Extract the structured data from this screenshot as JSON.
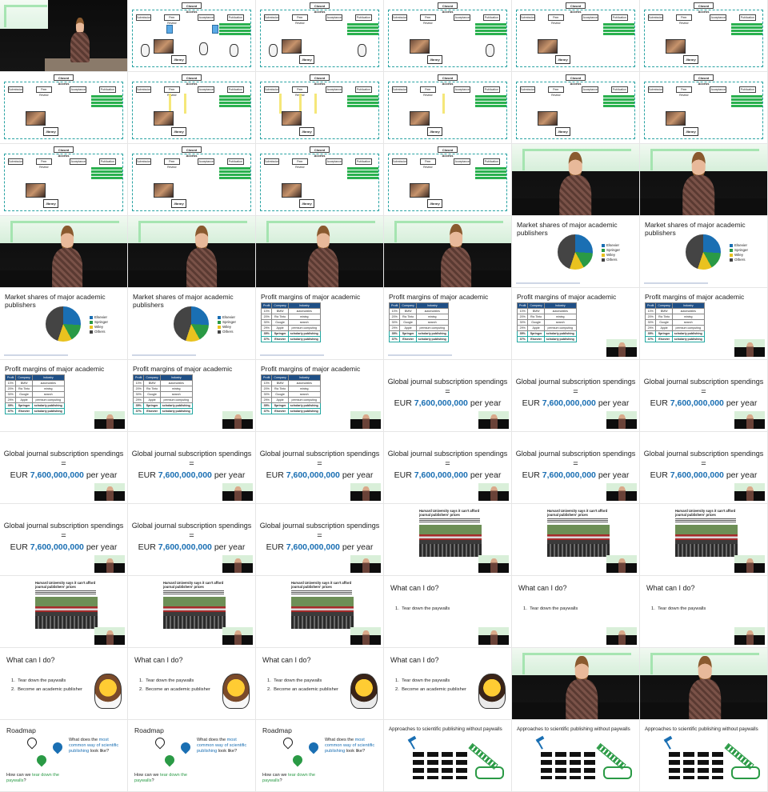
{
  "diagram": {
    "title": "Closed Access",
    "boxes": [
      "Submission",
      "Peer Review",
      "Acceptance",
      "Publication"
    ],
    "label_top": "Evaluation",
    "label_right_1": "Research",
    "label_right_2": "Publishing $ Services",
    "library_text": "library"
  },
  "pie_slide": {
    "title": "Market shares of major academic publishers",
    "legend": [
      "Elsevier",
      "Springer",
      "Wiley",
      "Others"
    ],
    "colors": [
      "#1a6fb3",
      "#2a9a45",
      "#e9c21f",
      "#444444"
    ]
  },
  "profit_slide": {
    "title": "Profit margins of major academic publishers",
    "columns": [
      "Profit",
      "Company",
      "Industry"
    ],
    "rows": [
      [
        "10%",
        "BMW",
        "automobiles"
      ],
      [
        "20%",
        "Rio Tinto",
        "mining"
      ],
      [
        "30%",
        "Google",
        "search"
      ],
      [
        "29%",
        "Apple",
        "premium computing"
      ],
      [
        "35%",
        "Springer",
        "scholarly publishing"
      ],
      [
        "37%",
        "Elsevier",
        "scholarly publishing"
      ]
    ]
  },
  "spend_slide": {
    "title": "Global journal subscription spendings",
    "equals": "=",
    "prefix": "EUR ",
    "amount": "7,600,000,000",
    "suffix": " per year"
  },
  "news_slide": {
    "headline": "Harvard University says it can't afford journal publishers' prices"
  },
  "todo_slide": {
    "title": "What can I do?",
    "item1": "Tear down the paywalls",
    "item2": "Become an academic publisher"
  },
  "roadmap_slide": {
    "title": "Roadmap",
    "q1_a": "What does the ",
    "q1_b": "most common way of scientific publishing",
    "q1_c": " look like?",
    "q2_a": "How can we ",
    "q2_b": "tear down the paywalls",
    "q2_c": "?"
  },
  "approach_slide": {
    "title": "Approaches to scientific publishing without paywalls"
  }
}
